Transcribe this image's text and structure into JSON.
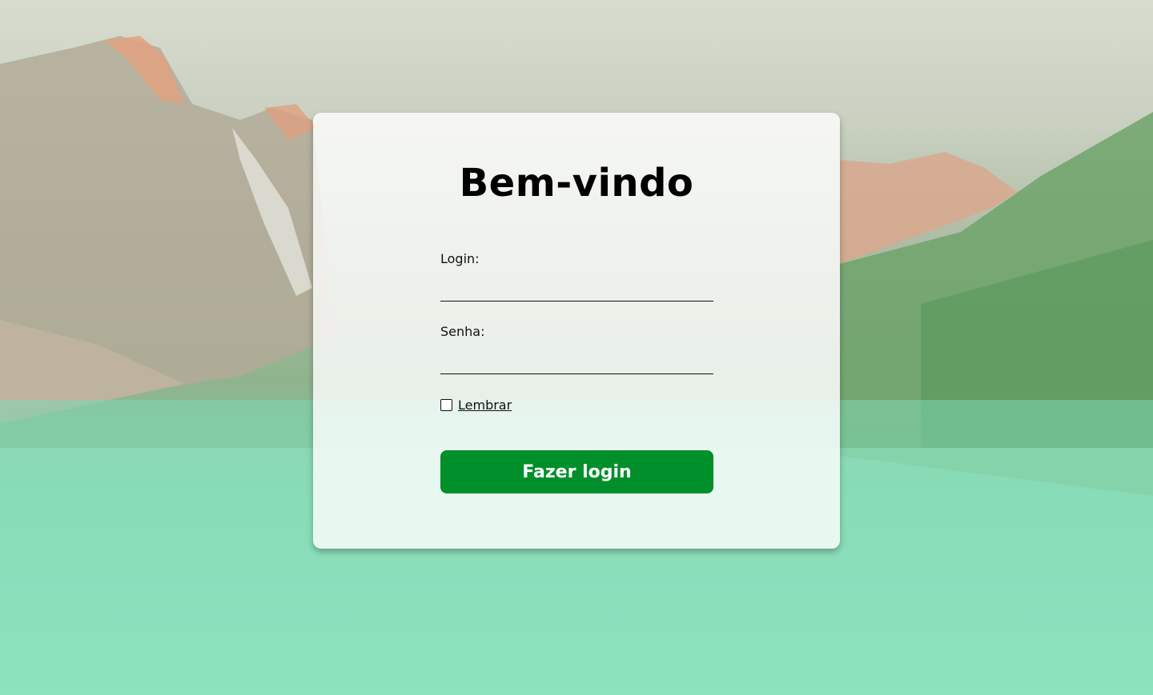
{
  "page": {
    "title": "Bem-vindo",
    "background_image": "mountain-lake-landscape"
  },
  "form": {
    "login_label": "Login:",
    "login_value": "",
    "password_label": "Senha:",
    "password_value": "",
    "remember_label": "Lembrar",
    "remember_checked": false,
    "submit_label": "Fazer login"
  },
  "colors": {
    "button": "#008f2b",
    "card": "#ffffff"
  }
}
